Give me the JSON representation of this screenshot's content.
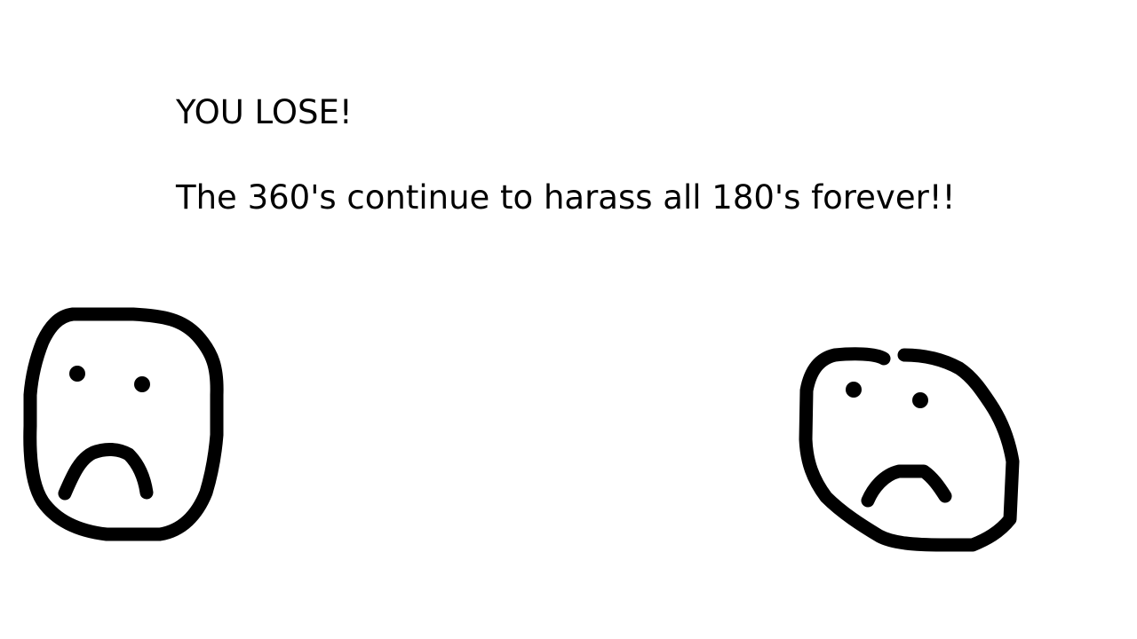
{
  "screen": {
    "name": "game-over",
    "background_color": "#ffffff",
    "ink_color": "#000000"
  },
  "headline": "YOU LOSE!",
  "message": "The 360's continue to harass all 180's forever!!",
  "faces": [
    {
      "name": "sad-face-left",
      "expression": "sad"
    },
    {
      "name": "sad-face-right",
      "expression": "sad"
    }
  ]
}
